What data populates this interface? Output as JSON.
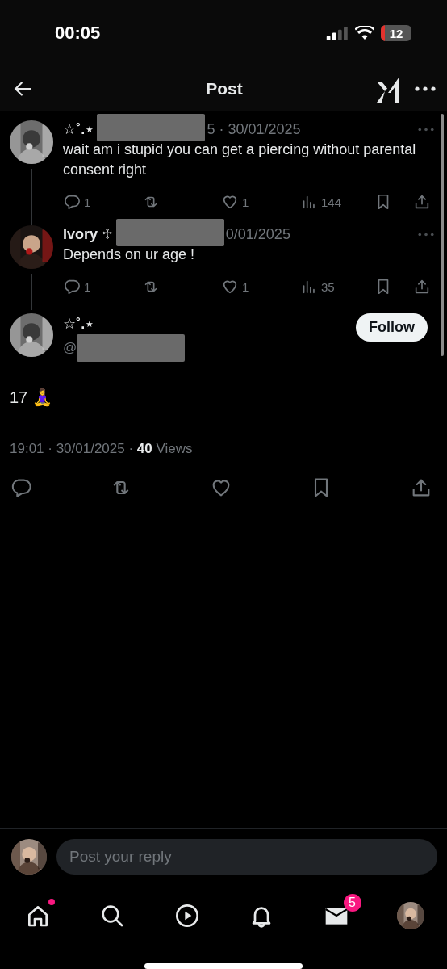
{
  "status_bar": {
    "time": "00:05",
    "battery": "12"
  },
  "header": {
    "title": "Post"
  },
  "replies": [
    {
      "name": "☆˚.⋆",
      "meta": "5 · 30/01/2025",
      "text": "wait am i stupid you can get a piercing without parental consent right",
      "actions": [
        {
          "kind": "comment",
          "count": "1"
        },
        {
          "kind": "retweet"
        },
        {
          "kind": "like",
          "count": "1"
        },
        {
          "kind": "views",
          "count": "144"
        },
        {
          "kind": "bookmark"
        },
        {
          "kind": "share"
        }
      ]
    },
    {
      "name": "Ivory ♱",
      "meta": "0/01/2025",
      "text": "Depends on ur age !",
      "actions": [
        {
          "kind": "comment",
          "count": "1"
        },
        {
          "kind": "retweet"
        },
        {
          "kind": "like",
          "count": "1"
        },
        {
          "kind": "views",
          "count": "35"
        },
        {
          "kind": "bookmark"
        },
        {
          "kind": "share"
        }
      ]
    }
  ],
  "post": {
    "name": "☆˚.⋆",
    "handle": "@",
    "follow_label": "Follow",
    "text": "17 🧘‍♀️",
    "meta": "19:01 · 30/01/2025 · **40** Views",
    "actions": [
      {
        "kind": "comment"
      },
      {
        "kind": "retweet"
      },
      {
        "kind": "like"
      },
      {
        "kind": "bookmark"
      },
      {
        "kind": "share"
      }
    ]
  },
  "reply_bar": {
    "placeholder": "Post your reply"
  },
  "nav": [
    {
      "kind": "home",
      "dot": true
    },
    {
      "kind": "search"
    },
    {
      "kind": "video"
    },
    {
      "kind": "bell"
    },
    {
      "kind": "mail",
      "badge": "5"
    },
    {
      "kind": "profile"
    }
  ]
}
